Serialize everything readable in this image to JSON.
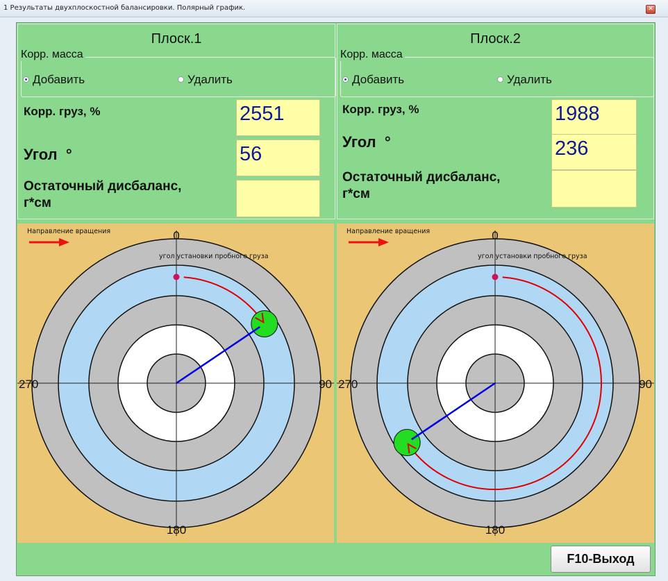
{
  "window": {
    "title": "1 Результаты двухплоскостной балансировки. Полярный график."
  },
  "planes": [
    {
      "title": "Плоск.1",
      "group_label": "Корр. масса",
      "radio_add": "Добавить",
      "radio_remove": "Удалить",
      "selected": "add",
      "weight_label": "Корр. груз, %",
      "weight_value": "2551",
      "angle_label": "Угол",
      "angle_unit": "°",
      "angle_value": "56",
      "residual_label": "Остаточный дисбаланс,",
      "residual_unit": "г*см",
      "residual_value": ""
    },
    {
      "title": "Плоск.2",
      "group_label": "Корр. масса",
      "radio_add": "Добавить",
      "radio_remove": "Удалить",
      "selected": "add",
      "weight_label": "Корр. груз, %",
      "weight_value": "1988",
      "angle_label": "Угол",
      "angle_unit": "°",
      "angle_value": "236",
      "residual_label": "Остаточный дисбаланс,",
      "residual_unit": "г*см",
      "residual_value": ""
    }
  ],
  "chart_data": [
    {
      "type": "polar",
      "rotation_label": "Направление вращения",
      "trial_label": "угол установки пробного груза",
      "axis_labels": {
        "top": "0",
        "right": "90",
        "bottom": "180",
        "left": "270"
      },
      "trial_angle": 0,
      "correction_angle": 56,
      "colors": {
        "background": "#EBC675",
        "ring_gray": "#C0C0C0",
        "ring_blue": "#B0D8F4",
        "center": "#FFFFFF",
        "vector": "#0000E6",
        "arc": "#E00000",
        "weight": "#22DD22",
        "trial_dot": "#D0105A",
        "arrow": "#EE1111"
      }
    },
    {
      "type": "polar",
      "rotation_label": "Направление вращения",
      "trial_label": "угол установки пробного груза",
      "axis_labels": {
        "top": "0",
        "right": "90",
        "bottom": "180",
        "left": "270"
      },
      "trial_angle": 0,
      "correction_angle": 236,
      "colors": {
        "background": "#EBC675",
        "ring_gray": "#C0C0C0",
        "ring_blue": "#B0D8F4",
        "center": "#FFFFFF",
        "vector": "#0000E6",
        "arc": "#E00000",
        "weight": "#22DD22",
        "trial_dot": "#D0105A",
        "arrow": "#EE1111"
      }
    }
  ],
  "footer": {
    "exit_label": "F10-Выход"
  }
}
